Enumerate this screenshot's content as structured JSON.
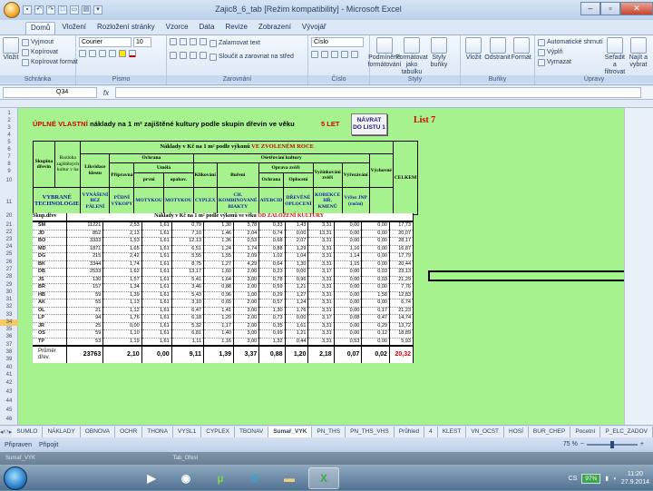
{
  "window": {
    "title": "Zajic8_6_tab  [Režim kompatibility] - Microsoft Excel",
    "minimize_label": "–",
    "maximize_label": "▫",
    "close_label": "✕"
  },
  "ribbon_tabs": [
    "Domů",
    "Vložení",
    "Rozložení stránky",
    "Vzorce",
    "Data",
    "Revize",
    "Zobrazení",
    "Vývojář"
  ],
  "ribbon": {
    "clipboard": {
      "paste": "Vložit",
      "cut": "Vyjmout",
      "copy": "Kopírovat",
      "format_painter": "Kopírovat formát",
      "label": "Schránka"
    },
    "font": {
      "name": "Courier",
      "size": "10",
      "label": "Písmo"
    },
    "alignment": {
      "wrap": "Zalamovat text",
      "merge": "Sloučit a zarovnat na střed",
      "label": "Zarovnání"
    },
    "number": {
      "format": "Číslo",
      "label": "Číslo"
    },
    "styles": {
      "conditional": "Podmíněné formátování",
      "as_table": "Formátovat jako tabulku",
      "cell_styles": "Styly buňky",
      "label": "Styly"
    },
    "cells": {
      "insert": "Vložit",
      "delete": "Odstranit",
      "format": "Formát",
      "label": "Buňky"
    },
    "editing": {
      "autosum": "Automatické shrnutí",
      "fill": "Výplň",
      "clear": "Vymazat",
      "sort": "Seřadit a filtrovat",
      "find": "Najít a vybrat",
      "label": "Úpravy"
    }
  },
  "formula_bar": {
    "name_box": "Q34",
    "fx": "fx",
    "value": ""
  },
  "sheet": {
    "title_red": "ÚPLNÉ VLASTNÍ",
    "title_black": " náklady na 1 m² zajištěné kultury podle skupin dřevin ve věku",
    "title_age": "5 LET",
    "nav_button": "NÁVRAT DO LISTU 1",
    "list_label": "List 7",
    "header": {
      "species_group": "Skupina dřevin",
      "area_hdr": "Rozloha zajištěných kultur v ha",
      "costs_title": "Náklady v Kč na 1 m² podle výkonů",
      "costs_title_red": "VE ZVOLENÉM ROCE",
      "clearing": "Likvidace klestu",
      "protection": "Ochrana",
      "preparation": "Přípravná",
      "planting": "Umělá",
      "first": "první",
      "repeat": "opakov.",
      "care": "Ošetřování kultury",
      "guard": "Ochrana",
      "cleaning": "Klikování",
      "weeding": "Buření",
      "repair": "Oprava zvěři",
      "fence": "Oplocení",
      "hunting": "Vyžínkování zvěři",
      "spot": "Výřezávání",
      "thinning": "Výchovné",
      "total": "CELKEM",
      "tech_label": "VYBRANÉ TECHNOLOGIE",
      "t1": "VYNÁŠENÍ BEZ PÁLENÍ",
      "t2": "PŮDNÍ VÝKOPY",
      "t3": "MOTYKOU",
      "t4": "MOTYKOU",
      "t5": "CYPLEX",
      "t6": "CH. KOMBINOVANÉ BIAKTY",
      "t7": "ATEBCID",
      "t8": "DŘEVĚNÉ OPLOCENÍ",
      "t9": "KOREKCE HŘ. KMENŮ",
      "t10": "Výřez JNP (ruční)",
      "sub_left": "Skup.dřev",
      "sub_title": "Náklady v Kč na 1 m² podle výkonů ve věku",
      "sub_title_red": "OD ZALOŽENÍ KULTURY"
    },
    "rows": [
      [
        "SM",
        "11221",
        "2,53",
        "1,61",
        "0,79",
        "1,30",
        "3,78",
        "0,33",
        "1,43",
        "3,31",
        "0,00",
        "0,00",
        "17,73"
      ],
      [
        "JD",
        "852",
        "2,13",
        "1,61",
        "7,10",
        "1,46",
        "2,04",
        "0,74",
        "0,00",
        "13,31",
        "0,00",
        "0,00",
        "20,07"
      ],
      [
        "BO",
        "3333",
        "1,53",
        "1,61",
        "12,13",
        "1,36",
        "0,53",
        "0,68",
        "2,07",
        "3,31",
        "0,00",
        "0,00",
        "28,17"
      ],
      [
        "MD",
        "1871",
        "1,65",
        "1,61",
        "6,51",
        "1,24",
        "1,74",
        "0,88",
        "1,29",
        "3,31",
        "1,16",
        "0,00",
        "16,87"
      ],
      [
        "DG",
        "215",
        "2,42",
        "1,61",
        "5,55",
        "1,55",
        "2,09",
        "1,02",
        "1,04",
        "3,31",
        "1,14",
        "0,00",
        "17,79"
      ],
      [
        "BK",
        "3344",
        "1,74",
        "1,61",
        "8,75",
        "1,27",
        "4,29",
        "0,64",
        "1,30",
        "3,31",
        "1,15",
        "0,00",
        "20,44"
      ],
      [
        "DB",
        "2533",
        "1,62",
        "1,61",
        "13,17",
        "1,60",
        "2,00",
        "0,23",
        "0,00",
        "3,17",
        "0,00",
        "0,03",
        "23,13"
      ],
      [
        "JS",
        "130",
        "1,57",
        "1,61",
        "5,41",
        "1,64",
        "3,00",
        "0,78",
        "0,96",
        "3,31",
        "0,00",
        "0,03",
        "21,29"
      ],
      [
        "BŘ",
        "157",
        "1,34",
        "1,61",
        "3,46",
        "0,88",
        "2,00",
        "0,59",
        "1,21",
        "3,31",
        "0,00",
        "0,00",
        "7,76"
      ],
      [
        "HB",
        "59",
        "1,39",
        "1,61",
        "5,43",
        "0,96",
        "1,00",
        "0,29",
        "1,27",
        "3,31",
        "0,00",
        "1,58",
        "12,83"
      ],
      [
        "AK",
        "55",
        "1,13",
        "1,61",
        "3,10",
        "0,65",
        "2,00",
        "0,57",
        "1,24",
        "3,31",
        "0,00",
        "0,00",
        "6,74"
      ],
      [
        "OL",
        "21",
        "1,12",
        "1,61",
        "6,47",
        "1,41",
        "3,00",
        "1,30",
        "1,76",
        "3,31",
        "0,00",
        "0,17",
        "21,23"
      ],
      [
        "LP",
        "94",
        "1,76",
        "1,61",
        "6,18",
        "1,20",
        "2,00",
        "0,73",
        "0,00",
        "3,17",
        "0,08",
        "0,47",
        "14,74"
      ],
      [
        "JR",
        "25",
        "0,00",
        "1,61",
        "5,32",
        "1,17",
        "2,00",
        "0,35",
        "1,61",
        "3,31",
        "0,00",
        "0,29",
        "13,72"
      ],
      [
        "OS",
        "59",
        "1,10",
        "1,61",
        "6,81",
        "1,40",
        "3,00",
        "0,99",
        "1,21",
        "3,31",
        "0,00",
        "0,12",
        "18,89"
      ],
      [
        "TP",
        "53",
        "1,19",
        "1,61",
        "1,11",
        "1,16",
        "3,00",
        "1,32",
        "0,44",
        "3,31",
        "0,53",
        "0,00",
        "5,93"
      ]
    ],
    "total": [
      "Průměr dřev.",
      "23763",
      "2,10",
      "0,00",
      "9,11",
      "1,39",
      "3,37",
      "0,88",
      "1,20",
      "2,18",
      "0,07",
      "0,02",
      "20,32"
    ],
    "row_numbers": [
      "1",
      "2",
      "3",
      "4",
      "5",
      "6",
      "7",
      "8",
      "9",
      "10",
      "11",
      "20",
      "21",
      "22",
      "23",
      "24",
      "25",
      "26",
      "27",
      "28",
      "29",
      "30",
      "31",
      "32",
      "33",
      "34",
      "35",
      "36",
      "37",
      "38",
      "39",
      "40",
      "41",
      "42",
      "43",
      "44",
      "45",
      "46",
      "47",
      "48"
    ],
    "selected_row": "34"
  },
  "sheet_tabs": [
    "SUMLO",
    "NÁKLADY",
    "OBNOVA",
    "OCHR",
    "THONA",
    "VYSL1",
    "CYPLEX",
    "TBONAV",
    "Sumař_VYK",
    "PN_THS",
    "PN_THS_VHS",
    "Průhled",
    "4",
    "KLEST",
    "VN_OCST",
    "HOSÍ",
    "BUR_CHEP",
    "Pocetní",
    "P_ELC_ZADOV"
  ],
  "active_sheet_tab": "Sumař_VYK",
  "status": {
    "ready": "Připraven",
    "mode": "Připojit",
    "zoom": "75 %"
  },
  "taskbar": {
    "time": "11:20",
    "date": "27.9.2014",
    "lang": "CS",
    "battery": "97%"
  },
  "desktop_strip": [
    "Sumař_VYK",
    "Tab_Ořesí"
  ]
}
